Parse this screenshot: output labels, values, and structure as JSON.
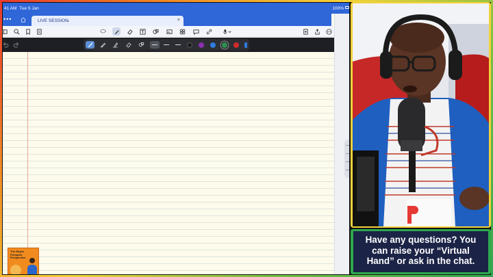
{
  "status_bar": {
    "time": "41 AM",
    "date": "Tue 9 Jan",
    "battery": "100%"
  },
  "notebook": {
    "tab_title": "LIVE SESSION",
    "tab_chevron": "⌄",
    "tab_close": "×"
  },
  "thumbnail": {
    "title": "The Shyke Prempeh Perspective"
  },
  "colors": {
    "ipad_blue": "#2f66d8",
    "paper": "#fdfbec",
    "caption_bg": "#1b2346",
    "swatches": [
      "#222222",
      "#8b2fb0",
      "#2f7be0",
      "#2f8f4f",
      "#d12a2a"
    ]
  },
  "caption": {
    "line1": "Have any questions? You",
    "line2": "can raise your “Virtual",
    "line3": "Hand” or ask in the chat."
  },
  "icons": {
    "toolbar": [
      "sidebar-icon",
      "search-icon",
      "bookmark-add-icon",
      "pages-icon",
      "lasso-icon",
      "pen-icon",
      "eraser-icon",
      "text-box-icon",
      "shape-icon",
      "image-icon",
      "elements-icon",
      "note-icon",
      "link-icon",
      "microphone-icon",
      "add-page-icon",
      "share-icon",
      "more-icon"
    ]
  }
}
